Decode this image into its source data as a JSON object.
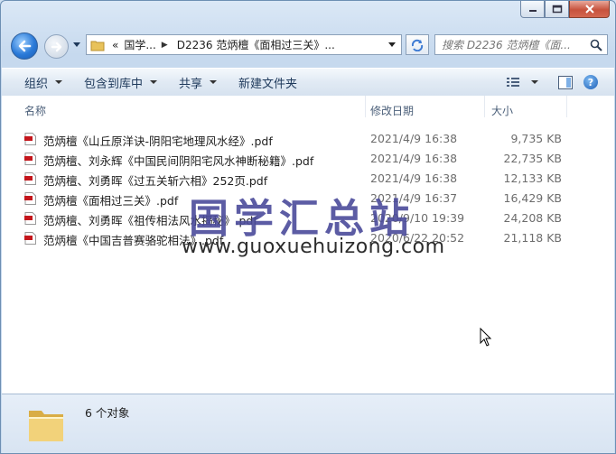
{
  "window": {
    "address_crumbs": [
      "«",
      "国学...",
      "D2236 范炳檀《面相过三关》..."
    ],
    "search_placeholder": "搜索 D2236 范炳檀《面..."
  },
  "toolbar": {
    "organize": "组织",
    "include_in_library": "包含到库中",
    "share": "共享",
    "new_folder": "新建文件夹"
  },
  "columns": {
    "name": "名称",
    "date": "修改日期",
    "size": "大小"
  },
  "files": [
    {
      "name": "范炳檀《山丘原洋诀-阴阳宅地理风水经》.pdf",
      "date": "2021/4/9 16:38",
      "size": "9,735 KB"
    },
    {
      "name": "范炳檀、刘永辉《中国民间阴阳宅风水神断秘籍》.pdf",
      "date": "2021/4/9 16:38",
      "size": "22,735 KB"
    },
    {
      "name": "范炳檀、刘勇晖《过五关斩六相》252页.pdf",
      "date": "2021/4/9 16:38",
      "size": "12,133 KB"
    },
    {
      "name": "范炳檀《面相过三关》.pdf",
      "date": "2021/4/9 16:37",
      "size": "16,429 KB"
    },
    {
      "name": "范炳檀、刘勇晖《祖传相法风水揭秘》.pdf",
      "date": "2020/9/10 19:39",
      "size": "24,208 KB"
    },
    {
      "name": "范炳檀《中国吉普赛骆驼相法》.pdf",
      "date": "2020/6/22 20:52",
      "size": "21,118 KB"
    }
  ],
  "watermark": {
    "title": "国学汇总站",
    "url": "www.guoxuehuizong.com"
  },
  "status": {
    "count": "6 个对象"
  },
  "icons": {
    "back": "back-arrow-icon",
    "forward": "forward-arrow-icon",
    "folder": "folder-icon",
    "refresh": "refresh-icon",
    "search": "search-icon",
    "pdf": "pdf-file-icon",
    "view": "view-options-icon",
    "preview": "preview-pane-icon",
    "help": "help-icon"
  },
  "colors": {
    "toolbar_text": "#1e395b",
    "watermark": "#4b4b9b",
    "pdf_red": "#c4161c"
  }
}
